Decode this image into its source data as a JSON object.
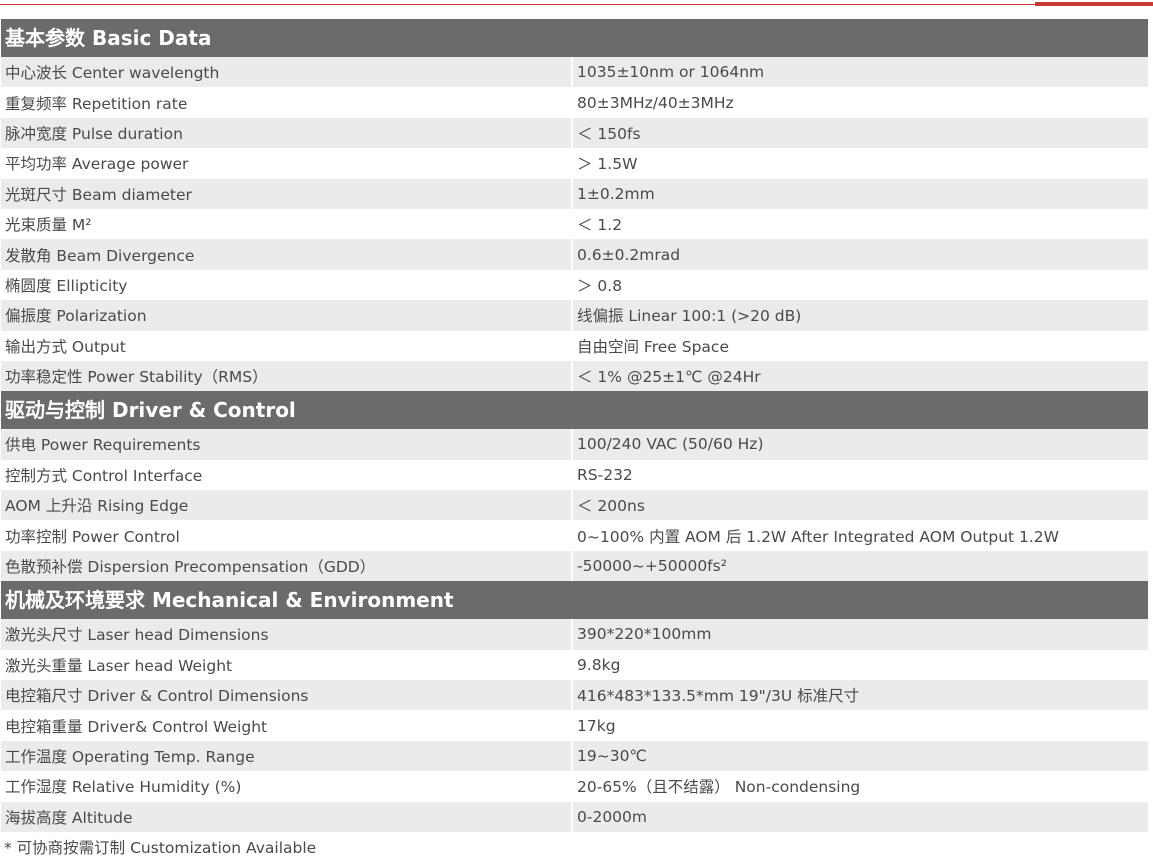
{
  "sections": [
    {
      "title": "基本参数 Basic Data",
      "rows": [
        {
          "label": "中心波长 Center wavelength",
          "value": "1035±10nm or 1064nm"
        },
        {
          "label": "重复频率 Repetition rate",
          "value": "80±3MHz/40±3MHz"
        },
        {
          "label": "脉冲宽度 Pulse duration",
          "value": "＜ 150fs"
        },
        {
          "label": "平均功率 Average power",
          "value": "＞ 1.5W"
        },
        {
          "label": "光斑尺寸 Beam diameter",
          "value": "1±0.2mm"
        },
        {
          "label": "光束质量 M²",
          "value": "＜ 1.2"
        },
        {
          "label": "发散角 Beam Divergence",
          "value": "0.6±0.2mrad"
        },
        {
          "label": "椭圆度 Ellipticity",
          "value": "＞ 0.8"
        },
        {
          "label": "偏振度 Polarization",
          "value": "线偏振 Linear 100:1 (>20 dB)"
        },
        {
          "label": "输出方式 Output",
          "value": "自由空间 Free Space"
        },
        {
          "label": "功率稳定性 Power Stability（RMS）",
          "value": "＜ 1% @25±1℃ @24Hr"
        }
      ]
    },
    {
      "title": "驱动与控制 Driver & Control",
      "rows": [
        {
          "label": "供电 Power Requirements",
          "value": "100/240 VAC (50/60 Hz)"
        },
        {
          "label": "控制方式 Control Interface",
          "value": "RS-232"
        },
        {
          "label": "AOM 上升沿 Rising Edge",
          "value": "＜ 200ns"
        },
        {
          "label": "功率控制 Power Control",
          "value": "0~100% 内置 AOM 后 1.2W    After Integrated AOM Output 1.2W"
        },
        {
          "label": "色散预补偿 Dispersion Precompensation（GDD）",
          "value": "-50000~+50000fs²"
        }
      ]
    },
    {
      "title": "机械及环境要求 Mechanical & Environment",
      "rows": [
        {
          "label": "激光头尺寸 Laser head Dimensions",
          "value": "390*220*100mm"
        },
        {
          "label": "激光头重量 Laser head Weight",
          "value": "9.8kg"
        },
        {
          "label": "电控箱尺寸 Driver & Control Dimensions",
          "value": "416*483*133.5*mm    19\"/3U 标准尺寸"
        },
        {
          "label": "电控箱重量 Driver& Control Weight",
          "value": "17kg"
        },
        {
          "label": "工作温度 Operating Temp. Range",
          "value": "19~30℃"
        },
        {
          "label": "工作湿度 Relative Humidity (%)",
          "value": "20-65%（且不结露） Non-condensing"
        },
        {
          "label": "海拔高度 Altitude",
          "value": "0-2000m"
        }
      ]
    }
  ],
  "footnote": "* 可协商按需订制 Customization Available",
  "colors": {
    "accent": "#c93a35",
    "header_bg": "#6b6b6b",
    "row_shade": "#ebebeb",
    "text": "#4a4a4a"
  }
}
